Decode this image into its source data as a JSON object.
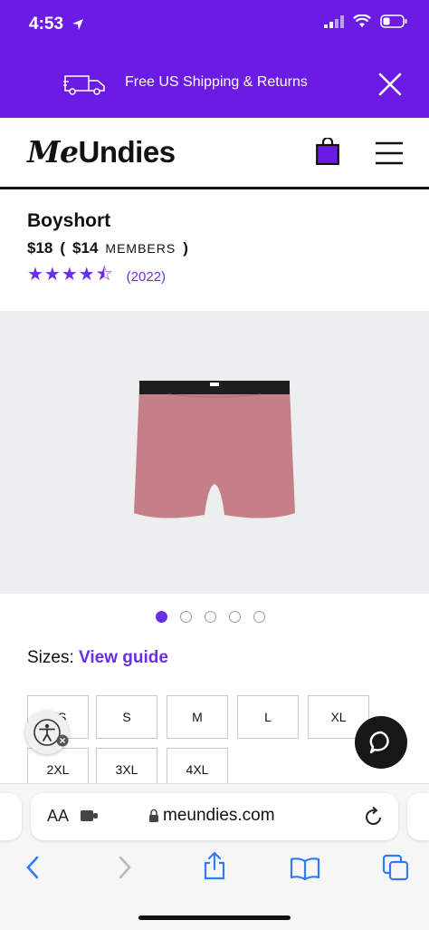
{
  "status": {
    "time": "4:53"
  },
  "promo": {
    "text": "Free US Shipping & Returns"
  },
  "header": {
    "logo_me": "Me",
    "logo_rest": "Undies"
  },
  "product": {
    "title": "Boyshort",
    "price": "$18",
    "open_paren": "(",
    "member_price": "$14",
    "members_label": "MEMBERS",
    "close_paren": ")",
    "stars": "★★★★⯪",
    "review_count": "(2022)"
  },
  "gallery": {
    "dot_count": 5,
    "active_index": 0
  },
  "sizes": {
    "label": "Sizes:",
    "guide_label": "View guide",
    "options": [
      "XS",
      "S",
      "M",
      "L",
      "XL",
      "2XL",
      "3XL",
      "4XL"
    ]
  },
  "browser": {
    "aa_label": "AA",
    "url": "meundies.com"
  },
  "colors": {
    "brand_purple": "#6b1be3",
    "accent_purple": "#6b2ee8",
    "image_bg": "#eceef0",
    "garment_pink": "#c57f87",
    "waistband": "#1e1e1e"
  }
}
